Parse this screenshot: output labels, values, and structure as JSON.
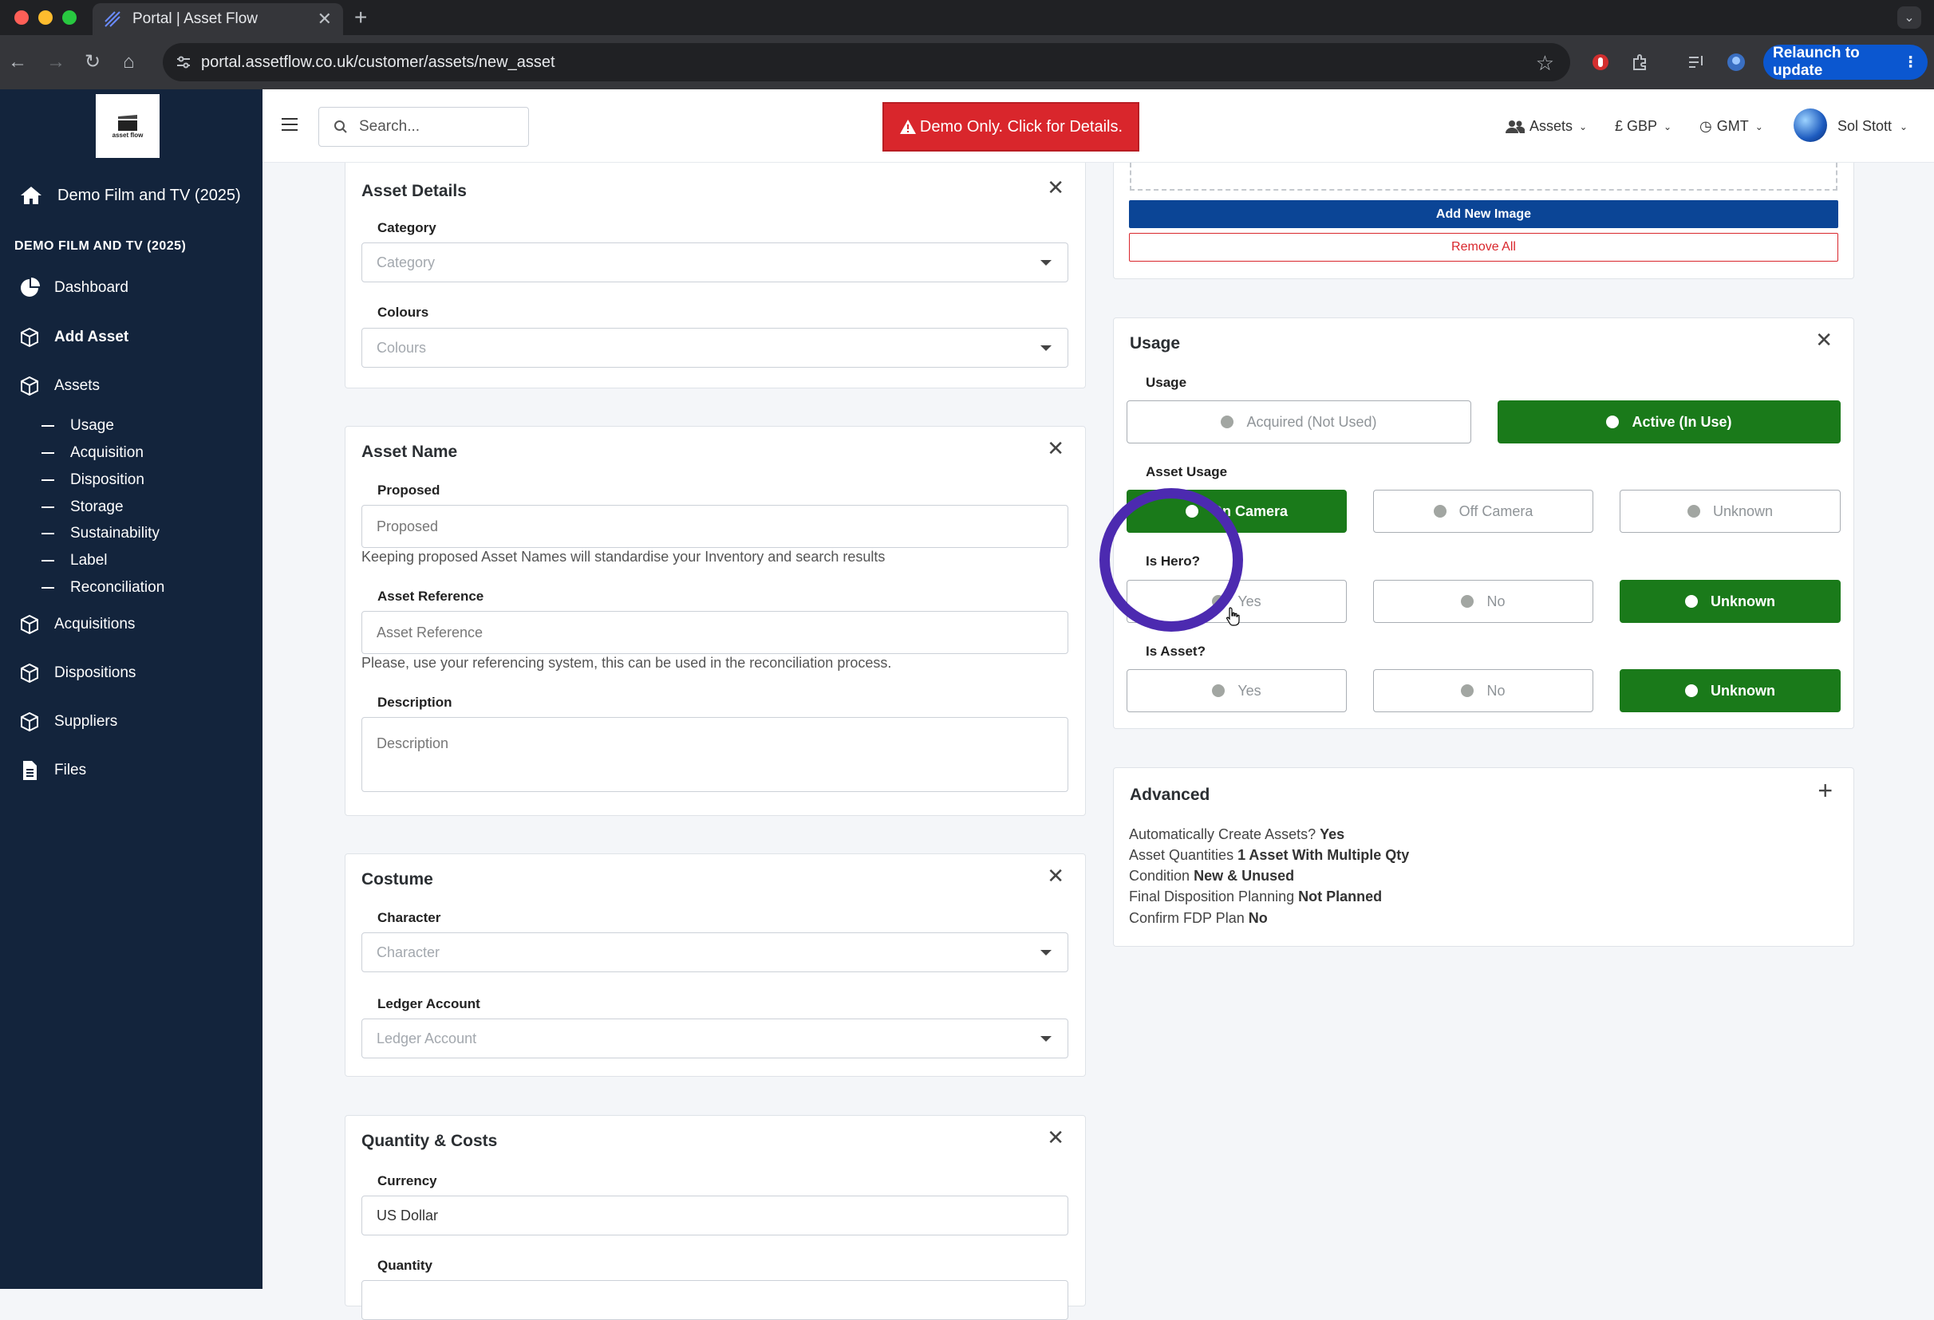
{
  "browser": {
    "tab_title": "Portal | Asset Flow",
    "url": "portal.assetflow.co.uk/customer/assets/new_asset",
    "relaunch_label": "Relaunch to update"
  },
  "sidebar": {
    "logo_text": "asset flow",
    "org_name": "Demo Film and TV (2025)",
    "section_header": "DEMO FILM AND TV (2025)",
    "items": [
      {
        "label": "Dashboard"
      },
      {
        "label": "Add Asset"
      },
      {
        "label": "Assets"
      }
    ],
    "sub_items": [
      "Usage",
      "Acquisition",
      "Disposition",
      "Storage",
      "Sustainability",
      "Label",
      "Reconciliation"
    ],
    "items_bottom": [
      {
        "label": "Acquisitions"
      },
      {
        "label": "Dispositions"
      },
      {
        "label": "Suppliers"
      },
      {
        "label": "Files"
      }
    ]
  },
  "topbar": {
    "search_placeholder": "Search...",
    "demo_banner": "Demo Only. Click for Details.",
    "assets_menu": "Assets",
    "currency_menu": "£ GBP",
    "timezone_menu": "GMT",
    "user_name": "Sol Stott"
  },
  "asset_details": {
    "title": "Asset Details",
    "category_label": "Category",
    "category_placeholder": "Category",
    "colours_label": "Colours",
    "colours_placeholder": "Colours"
  },
  "asset_name": {
    "title": "Asset Name",
    "proposed_label": "Proposed",
    "proposed_placeholder": "Proposed",
    "proposed_help": "Keeping proposed Asset Names will standardise your Inventory and search results",
    "reference_label": "Asset Reference",
    "reference_placeholder": "Asset Reference",
    "reference_help": "Please, use your referencing system, this can be used in the reconciliation process.",
    "description_label": "Description",
    "description_placeholder": "Description"
  },
  "costume": {
    "title": "Costume",
    "character_label": "Character",
    "character_placeholder": "Character",
    "ledger_label": "Ledger Account",
    "ledger_placeholder": "Ledger Account"
  },
  "quantity_costs": {
    "title": "Quantity & Costs",
    "currency_label": "Currency",
    "currency_value": "US Dollar",
    "quantity_label": "Quantity"
  },
  "images": {
    "add_button": "Add New Image",
    "remove_button": "Remove All"
  },
  "usage": {
    "title": "Usage",
    "usage_label": "Usage",
    "usage_options": [
      "Acquired (Not Used)",
      "Active (In Use)"
    ],
    "usage_selected": "Active (In Use)",
    "asset_usage_label": "Asset Usage",
    "asset_usage_options": [
      "On Camera",
      "Off Camera",
      "Unknown"
    ],
    "asset_usage_selected": "On Camera",
    "is_hero_label": "Is Hero?",
    "is_hero_options": [
      "Yes",
      "No",
      "Unknown"
    ],
    "is_hero_selected": "Unknown",
    "is_asset_label": "Is Asset?",
    "is_asset_options": [
      "Yes",
      "No",
      "Unknown"
    ],
    "is_asset_selected": "Unknown"
  },
  "advanced": {
    "title": "Advanced",
    "lines": [
      {
        "label": "Automatically Create Assets?",
        "value": "Yes"
      },
      {
        "label": "Asset Quantities",
        "value": "1 Asset With Multiple Qty"
      },
      {
        "label": "Condition",
        "value": "New & Unused"
      },
      {
        "label": "Final Disposition Planning",
        "value": "Not Planned"
      },
      {
        "label": "Confirm FDP Plan",
        "value": "No"
      }
    ]
  },
  "colors": {
    "sidebar_bg": "#13243c",
    "selected_green": "#1a7a1a",
    "demo_red": "#d9262c",
    "primary_blue": "#0b4596",
    "highlight_ring": "#4c2ab0"
  }
}
